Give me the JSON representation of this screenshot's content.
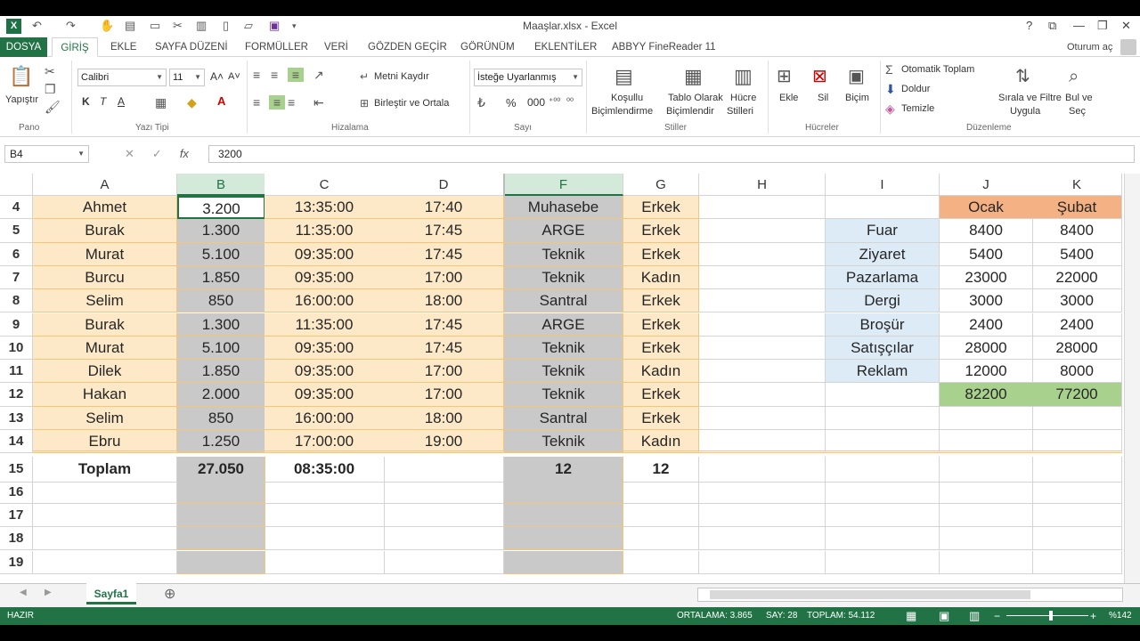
{
  "window": {
    "title": "Maaşlar.xlsx - Excel",
    "help": "?",
    "restore": "⧉",
    "minimize": "—",
    "maximize": "❐",
    "close": "✕"
  },
  "qat": {
    "undo": "↶",
    "redo": "↷"
  },
  "tabs": [
    "DOSYA",
    "GİRİŞ",
    "EKLE",
    "SAYFA DÜZENİ",
    "FORMÜLLER",
    "VERİ",
    "GÖZDEN GEÇİR",
    "GÖRÜNÜM",
    "EKLENTİLER",
    "ABBYY FineReader 11"
  ],
  "signin": "Oturum aç",
  "ribbon": {
    "paste": "Yapıştır",
    "font_name": "Calibri",
    "font_size": "11",
    "wrap_text": "Metni Kaydır",
    "merge_center": "Birleştir ve Ortala",
    "number_format": "İsteğe Uyarlanmış",
    "cond_format_1": "Koşullu",
    "cond_format_2": "Biçimlendirme",
    "format_table_1": "Tablo Olarak",
    "format_table_2": "Biçimlendir",
    "cell_styles_1": "Hücre",
    "cell_styles_2": "Stilleri",
    "insert": "Ekle",
    "delete": "Sil",
    "format": "Biçim",
    "autosum": "Otomatik Toplam",
    "fill": "Doldur",
    "clear": "Temizle",
    "sort_filter_1": "Sırala ve Filtre",
    "sort_filter_2": "Uygula",
    "find_select_1": "Bul ve",
    "find_select_2": "Seç",
    "groups": {
      "clipboard": "Pano",
      "font": "Yazı Tipi",
      "alignment": "Hizalama",
      "number": "Sayı",
      "styles": "Stiller",
      "cells": "Hücreler",
      "editing": "Düzenleme"
    }
  },
  "formula_bar": {
    "name_box": "B4",
    "formula": "3200",
    "fx": "fx"
  },
  "columns": [
    "A",
    "B",
    "C",
    "D",
    "F",
    "G",
    "H",
    "I",
    "J",
    "K"
  ],
  "rows": [
    {
      "n": "4",
      "A": "Ahmet",
      "B": "3.200",
      "C": "13:35:00",
      "D": "17:40",
      "F": "Muhasebe",
      "G": "Erkek",
      "I": "",
      "J": "Ocak",
      "K": "Şubat"
    },
    {
      "n": "5",
      "A": "Burak",
      "B": "1.300",
      "C": "11:35:00",
      "D": "17:45",
      "F": "ARGE",
      "G": "Erkek",
      "I": "Fuar",
      "J": "8400",
      "K": "8400"
    },
    {
      "n": "6",
      "A": "Murat",
      "B": "5.100",
      "C": "09:35:00",
      "D": "17:45",
      "F": "Teknik",
      "G": "Erkek",
      "I": "Ziyaret",
      "J": "5400",
      "K": "5400"
    },
    {
      "n": "7",
      "A": "Burcu",
      "B": "1.850",
      "C": "09:35:00",
      "D": "17:00",
      "F": "Teknik",
      "G": "Kadın",
      "I": "Pazarlama",
      "J": "23000",
      "K": "22000"
    },
    {
      "n": "8",
      "A": "Selim",
      "B": "850",
      "C": "16:00:00",
      "D": "18:00",
      "F": "Santral",
      "G": "Erkek",
      "I": "Dergi",
      "J": "3000",
      "K": "3000"
    },
    {
      "n": "9",
      "A": "Burak",
      "B": "1.300",
      "C": "11:35:00",
      "D": "17:45",
      "F": "ARGE",
      "G": "Erkek",
      "I": "Broşür",
      "J": "2400",
      "K": "2400"
    },
    {
      "n": "10",
      "A": "Murat",
      "B": "5.100",
      "C": "09:35:00",
      "D": "17:45",
      "F": "Teknik",
      "G": "Erkek",
      "I": "Satışçılar",
      "J": "28000",
      "K": "28000"
    },
    {
      "n": "11",
      "A": "Dilek",
      "B": "1.850",
      "C": "09:35:00",
      "D": "17:00",
      "F": "Teknik",
      "G": "Kadın",
      "I": "Reklam",
      "J": "12000",
      "K": "8000"
    },
    {
      "n": "12",
      "A": "Hakan",
      "B": "2.000",
      "C": "09:35:00",
      "D": "17:00",
      "F": "Teknik",
      "G": "Erkek",
      "I": "",
      "J": "82200",
      "K": "77200"
    },
    {
      "n": "13",
      "A": "Selim",
      "B": "850",
      "C": "16:00:00",
      "D": "18:00",
      "F": "Santral",
      "G": "Erkek",
      "I": "",
      "J": "",
      "K": ""
    },
    {
      "n": "14",
      "A": "Ebru",
      "B": "1.250",
      "C": "17:00:00",
      "D": "19:00",
      "F": "Teknik",
      "G": "Kadın",
      "I": "",
      "J": "",
      "K": ""
    },
    {
      "n": "15",
      "A": "Toplam",
      "B": "27.050",
      "C": "08:35:00",
      "D": "",
      "F": "12",
      "G": "12",
      "I": "",
      "J": "",
      "K": ""
    },
    {
      "n": "16",
      "A": "",
      "B": "",
      "C": "",
      "D": "",
      "F": "",
      "G": "",
      "I": "",
      "J": "",
      "K": ""
    },
    {
      "n": "17",
      "A": "",
      "B": "",
      "C": "",
      "D": "",
      "F": "",
      "G": "",
      "I": "",
      "J": "",
      "K": ""
    },
    {
      "n": "18",
      "A": "",
      "B": "",
      "C": "",
      "D": "",
      "F": "",
      "G": "",
      "I": "",
      "J": "",
      "K": ""
    },
    {
      "n": "19",
      "A": "",
      "B": "",
      "C": "",
      "D": "",
      "F": "",
      "G": "",
      "I": "",
      "J": "",
      "K": ""
    }
  ],
  "colors": {
    "excel_green": "#217346",
    "peach": "#fde9c8",
    "grey": "#c9c9c9",
    "orange": "#f4b183",
    "light_blue": "#ddebf7",
    "green_fill": "#a9d18e"
  },
  "sheet_tab": "Sayfa1",
  "status": {
    "ready": "HAZIR",
    "average": "ORTALAMA: 3.865",
    "count": "SAY: 28",
    "sum": "TOPLAM: 54.112",
    "zoom": "%142"
  }
}
